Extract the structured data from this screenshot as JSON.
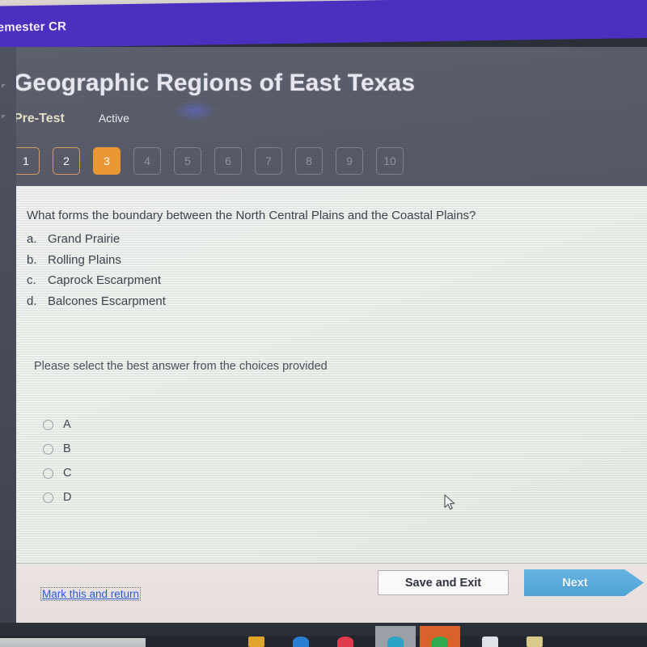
{
  "appbar": {
    "title": "st Semester CR",
    "color": "#4b2fbe"
  },
  "header": {
    "page_title": "Geographic Regions of East Texas",
    "assignment_type": "Pre-Test",
    "status": "Active",
    "background": "#565a68"
  },
  "pager": {
    "accent": "#eb9731",
    "items": [
      {
        "label": "1",
        "state": "done"
      },
      {
        "label": "2",
        "state": "done"
      },
      {
        "label": "3",
        "state": "current"
      },
      {
        "label": "4",
        "state": "todo"
      },
      {
        "label": "5",
        "state": "todo"
      },
      {
        "label": "6",
        "state": "todo"
      },
      {
        "label": "7",
        "state": "todo"
      },
      {
        "label": "8",
        "state": "todo"
      },
      {
        "label": "9",
        "state": "todo"
      },
      {
        "label": "10",
        "state": "todo"
      }
    ]
  },
  "question": {
    "prompt": "What forms the boundary between the North Central Plains and the Coastal Plains?",
    "options": [
      {
        "letter": "a.",
        "text": "Grand Prairie"
      },
      {
        "letter": "b.",
        "text": "Rolling Plains"
      },
      {
        "letter": "c.",
        "text": "Caprock Escarpment"
      },
      {
        "letter": "d.",
        "text": "Balcones Escarpment"
      }
    ],
    "instruction": "Please select the best answer from the choices provided",
    "choices": [
      {
        "label": "A",
        "selected": false
      },
      {
        "label": "B",
        "selected": false
      },
      {
        "label": "C",
        "selected": false
      },
      {
        "label": "D",
        "selected": false
      }
    ]
  },
  "footer": {
    "mark_link": "Mark this and return",
    "save_label": "Save and Exit",
    "next_label": "Next",
    "next_color": "#4fa3d6",
    "link_color": "#2a5bd7"
  }
}
